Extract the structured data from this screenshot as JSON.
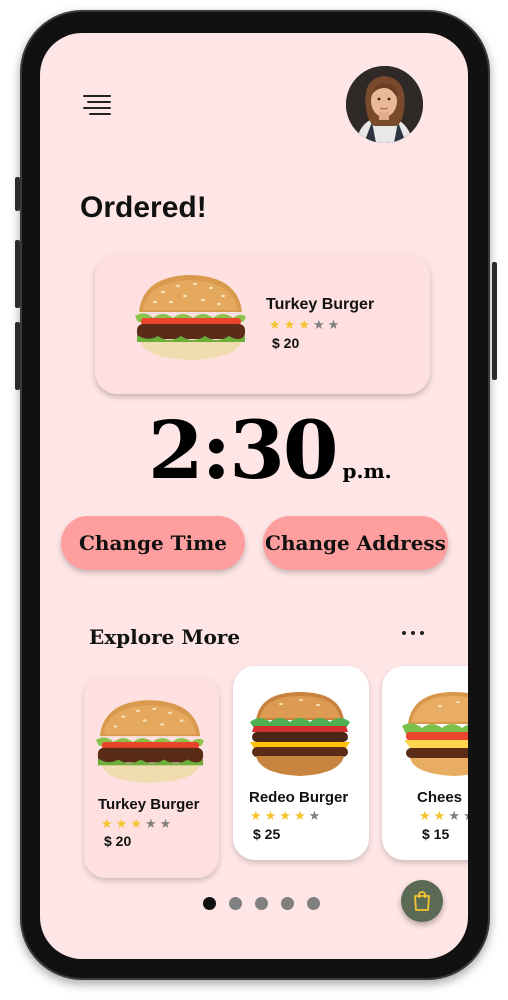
{
  "colors": {
    "screen_bg": "#ffe6e6",
    "pill_bg": "#ff9e9e",
    "star_on": "#f4c430",
    "star_off": "#808080",
    "bag_button": "#5b6a55"
  },
  "header": {
    "menu_icon": "hamburger-icon",
    "avatar": "user-avatar"
  },
  "page": {
    "title": "Ordered!"
  },
  "order": {
    "name": "Turkey Burger",
    "rating": 3,
    "rating_max": 5,
    "price": "$ 20"
  },
  "delivery": {
    "time": "2:30",
    "period": "p.m."
  },
  "actions": {
    "change_time": "Change Time",
    "change_address": "Change Address"
  },
  "explore": {
    "title": "Explore More",
    "more_icon": "more-horizontal-icon",
    "items": [
      {
        "name": "Turkey Burger",
        "rating": 3,
        "price": "$ 20"
      },
      {
        "name": "Redeo Burger",
        "rating": 4,
        "price": "$ 25"
      },
      {
        "name": "Chees",
        "rating": 2,
        "price": "$ 15"
      }
    ]
  },
  "pagination": {
    "count": 5,
    "active": 0
  },
  "fab": {
    "icon": "shopping-bag-icon"
  }
}
